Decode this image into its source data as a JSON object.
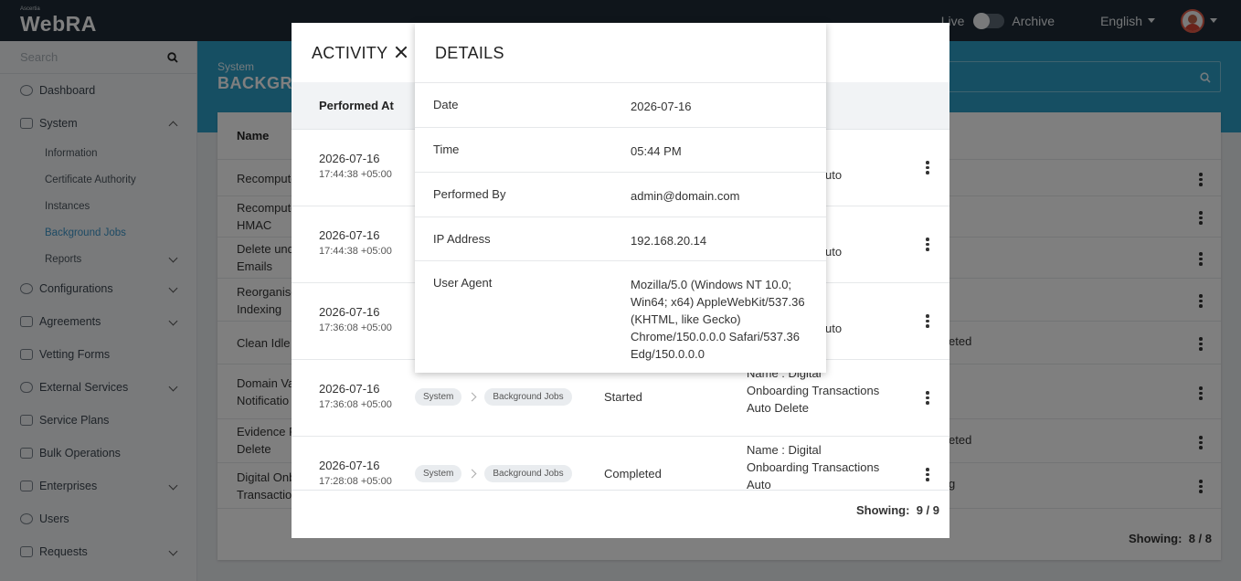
{
  "header": {
    "logo_small": "Ascertia",
    "logo": "WebRA",
    "live_label": "Live",
    "archive_label": "Archive",
    "language": "English"
  },
  "sidebar": {
    "search_placeholder": "Search",
    "items": [
      {
        "label": "Dashboard"
      },
      {
        "label": "System"
      },
      {
        "label": "Configurations"
      },
      {
        "label": "Agreements"
      },
      {
        "label": "Vetting Forms"
      },
      {
        "label": "External Services"
      },
      {
        "label": "Service Plans"
      },
      {
        "label": "Bulk Operations"
      },
      {
        "label": "Enterprises"
      },
      {
        "label": "Users"
      },
      {
        "label": "Requests"
      }
    ],
    "sub_items": [
      {
        "label": "Information"
      },
      {
        "label": "Certificate Authority"
      },
      {
        "label": "Instances"
      },
      {
        "label": "Background Jobs"
      },
      {
        "label": "Reports"
      }
    ]
  },
  "page": {
    "breadcrumb": "System",
    "title": "BACKGRO",
    "table_header": "Name",
    "rows": [
      {
        "name": "Recompute",
        "status": ""
      },
      {
        "name": "Recompute",
        "name2": "HMAC",
        "status": ""
      },
      {
        "name": "Delete und",
        "name2": "Emails",
        "status": ""
      },
      {
        "name": "Reorganise",
        "name2": "Indexing",
        "status": ""
      },
      {
        "name": "Clean Idle",
        "status": "eted"
      },
      {
        "name": "Domain Va",
        "name2": "Notificatio",
        "status": ""
      },
      {
        "name": "Evidence R",
        "name2": "Delete",
        "status": "eted"
      },
      {
        "name": "Digital Onb",
        "name2": "Transactio",
        "status": "g"
      }
    ],
    "showing_label": "Showing:",
    "showing_value": "8 / 8"
  },
  "activity": {
    "title": "ACTIVITY",
    "column_performed_at": "Performed At",
    "rows": [
      {
        "date": "2026-07-16",
        "time": "17:44:38 +05:00",
        "desc": "uto"
      },
      {
        "date": "2026-07-16",
        "time": "17:44:38 +05:00",
        "desc": "uto"
      },
      {
        "date": "2026-07-16",
        "time": "17:36:08 +05:00",
        "desc": "uto"
      },
      {
        "date": "2026-07-16",
        "time": "17:36:08 +05:00",
        "crumb1": "System",
        "crumb2": "Background Jobs",
        "status": "Started",
        "desc": "Name : Digital Onboarding Transactions Auto Delete"
      },
      {
        "date": "2026-07-16",
        "time": "17:28:08 +05:00",
        "crumb1": "System",
        "crumb2": "Background Jobs",
        "status": "Completed",
        "desc": "Name : Digital Onboarding Transactions Auto"
      }
    ],
    "showing_label": "Showing:",
    "showing_value": "9 / 9"
  },
  "details": {
    "title": "DETAILS",
    "fields": [
      {
        "label": "Date",
        "value": "2026-07-16"
      },
      {
        "label": "Time",
        "value": "05:44 PM"
      },
      {
        "label": "Performed By",
        "value": "admin@domain.com"
      },
      {
        "label": "IP Address",
        "value": "192.168.20.14"
      },
      {
        "label": "User Agent",
        "value": "Mozilla/5.0 (Windows NT 10.0; Win64; x64) AppleWebKit/537.36 (KHTML, like Gecko) Chrome/150.0.0.0 Safari/537.36 Edg/150.0.0.0"
      }
    ]
  }
}
